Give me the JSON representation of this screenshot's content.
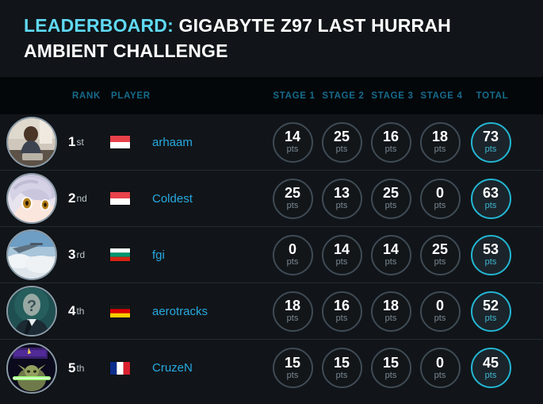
{
  "header": {
    "title_lead": "LEADERBOARD:",
    "title_rest": " GIGABYTE Z97 LAST HURRAH AMBIENT CHALLENGE"
  },
  "columns": {
    "rank": "RANK",
    "player": "PLAYER",
    "stage1": "STAGE 1",
    "stage2": "STAGE 2",
    "stage3": "STAGE 3",
    "stage4": "STAGE 4",
    "total": "TOTAL"
  },
  "unit": "pts",
  "colors": {
    "accent_cyan": "#5fd9f2",
    "player_name": "#28a9e0",
    "column_header": "#176b8c",
    "total_ring": "#23b6d3",
    "row_background": "#111519",
    "header_background": "#04070a"
  },
  "rows": [
    {
      "rank_num": "1",
      "rank_suffix": "st",
      "avatar": "photo-person-avatar",
      "flag": "flag-indonesia",
      "player": "arhaam",
      "stage1": "14",
      "stage2": "25",
      "stage3": "16",
      "stage4": "18",
      "total": "73"
    },
    {
      "rank_num": "2",
      "rank_suffix": "nd",
      "avatar": "anime-character-avatar",
      "flag": "flag-indonesia",
      "player": "Coldest",
      "stage1": "25",
      "stage2": "13",
      "stage3": "25",
      "stage4": "0",
      "total": "63"
    },
    {
      "rank_num": "3",
      "rank_suffix": "rd",
      "avatar": "sky-clouds-avatar",
      "flag": "flag-bulgaria",
      "player": "fgi",
      "stage1": "0",
      "stage2": "14",
      "stage3": "14",
      "stage4": "25",
      "total": "53"
    },
    {
      "rank_num": "4",
      "rank_suffix": "th",
      "avatar": "anonymous-question-avatar",
      "flag": "flag-germany",
      "player": "aerotracks",
      "stage1": "18",
      "stage2": "16",
      "stage3": "18",
      "stage4": "0",
      "total": "52"
    },
    {
      "rank_num": "5",
      "rank_suffix": "th",
      "avatar": "yoda-lightsaber-avatar",
      "flag": "flag-france",
      "player": "CruzeN",
      "stage1": "15",
      "stage2": "15",
      "stage3": "15",
      "stage4": "0",
      "total": "45"
    }
  ]
}
